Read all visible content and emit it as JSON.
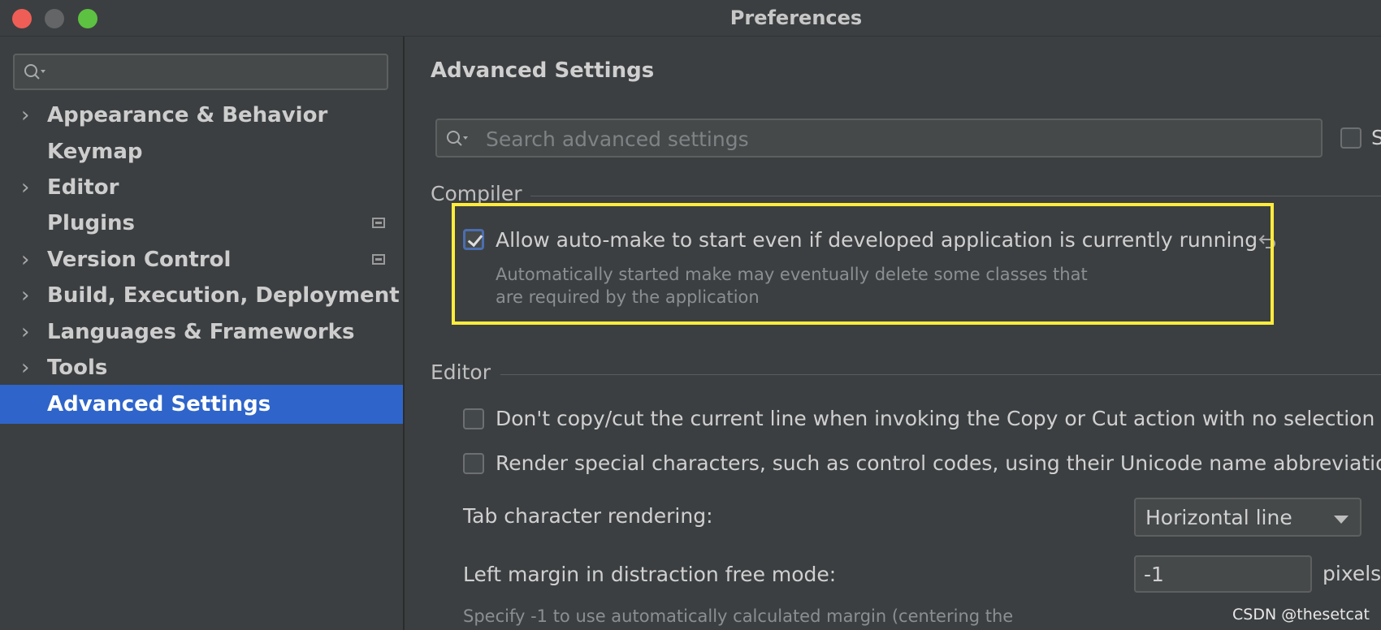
{
  "window": {
    "title": "Preferences",
    "traffic_lights": [
      {
        "name": "close",
        "color": "#ee5e56"
      },
      {
        "name": "minimize",
        "color": "#636566"
      },
      {
        "name": "zoom",
        "color": "#5dc141"
      }
    ]
  },
  "sidebar": {
    "search": {
      "placeholder": "",
      "icon": "search-icon"
    },
    "items": [
      {
        "label": "Appearance & Behavior",
        "expandable": true,
        "project_icon": false
      },
      {
        "label": "Keymap",
        "expandable": false,
        "project_icon": false
      },
      {
        "label": "Editor",
        "expandable": true,
        "project_icon": false
      },
      {
        "label": "Plugins",
        "expandable": false,
        "project_icon": true
      },
      {
        "label": "Version Control",
        "expandable": true,
        "project_icon": true
      },
      {
        "label": "Build, Execution, Deployment",
        "expandable": true,
        "project_icon": false
      },
      {
        "label": "Languages & Frameworks",
        "expandable": true,
        "project_icon": false
      },
      {
        "label": "Tools",
        "expandable": true,
        "project_icon": false
      },
      {
        "label": "Advanced Settings",
        "expandable": false,
        "project_icon": false,
        "selected": true
      }
    ],
    "selected_color": "#2f65ca"
  },
  "main": {
    "heading": "Advanced Settings",
    "search": {
      "placeholder": "Search advanced settings",
      "icon": "search-icon"
    },
    "side_checkbox_label": "S",
    "compiler": {
      "title": "Compiler",
      "option_label": "Allow auto-make to start even if developed application is currently running",
      "option_checked": true,
      "description_line1": "Automatically started make may eventually delete some classes that",
      "description_line2": "are required by the application",
      "highlight_color": "#ffec3d",
      "reset_icon": "undo-arrow-icon"
    },
    "editor": {
      "title": "Editor",
      "option1_label": "Don't copy/cut the current line when invoking the Copy or Cut action with no selection",
      "option1_checked": false,
      "option2_label": "Render special characters, such as control codes, using their Unicode name abbreviatio",
      "option2_checked": false,
      "tab_rendering_label": "Tab character rendering:",
      "tab_rendering_value": "Horizontal line",
      "left_margin_label": "Left margin in distraction free mode:",
      "left_margin_value": "-1",
      "left_margin_unit": "pixels",
      "left_margin_hint": "Specify -1 to use automatically calculated margin (centering the"
    }
  },
  "watermark": "CSDN @thesetcat"
}
